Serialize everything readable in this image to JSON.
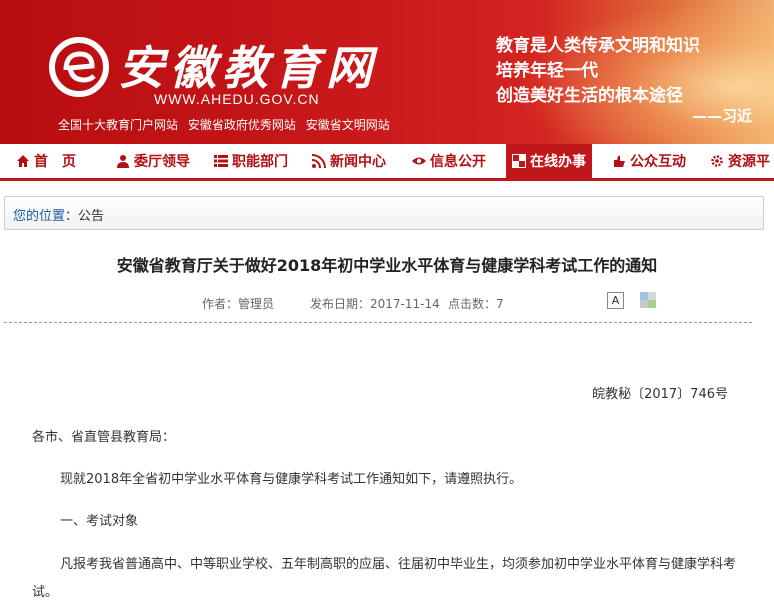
{
  "banner": {
    "logo": "安徽教育网",
    "url": "WWW.AHEDU.GOV.CN",
    "links": [
      "全国十大教育门户网站",
      "安徽省政府优秀网站",
      "安徽省文明网站"
    ],
    "slogan": [
      "教育是人类传承文明和知识",
      "培养年轻一代",
      "创造美好生活的根本途径"
    ],
    "author": "——习近"
  },
  "nav": {
    "items": [
      {
        "label": "首　页",
        "icon": "home-icon"
      },
      {
        "label": "委厅领导",
        "icon": "person-icon"
      },
      {
        "label": "职能部门",
        "icon": "list-icon"
      },
      {
        "label": "新闻中心",
        "icon": "rss-icon"
      },
      {
        "label": "信息公开",
        "icon": "eye-icon"
      },
      {
        "label": "在线办事",
        "icon": "grid-icon"
      },
      {
        "label": "公众互动",
        "icon": "hand-icon"
      },
      {
        "label": "资源平",
        "icon": "gear-icon"
      }
    ],
    "active_index": 5,
    "colors": {
      "accent": "#c0171b"
    }
  },
  "breadcrumb": {
    "prefix": "您的位置",
    "separator": "：",
    "current": "公告"
  },
  "article": {
    "title": "安徽省教育厅关于做好2018年初中学业水平体育与健康学科考试工作的通知",
    "author": "作者：管理员",
    "date": "发布日期：2017-11-14",
    "clicks": "点击数：7",
    "font_button": "A",
    "doc_number": "皖教秘〔2017〕746号",
    "salutation": "各市、省直管县教育局：",
    "intro": "现就2018年全省初中学业水平体育与健康学科考试工作通知如下，请遵照执行。",
    "section1": "一、考试对象",
    "para1": "凡报考我省普通高中、中等职业学校、五年制高职的应届、往届初中毕业生，均须参加初中学业水平体育与健康学科考试。"
  }
}
